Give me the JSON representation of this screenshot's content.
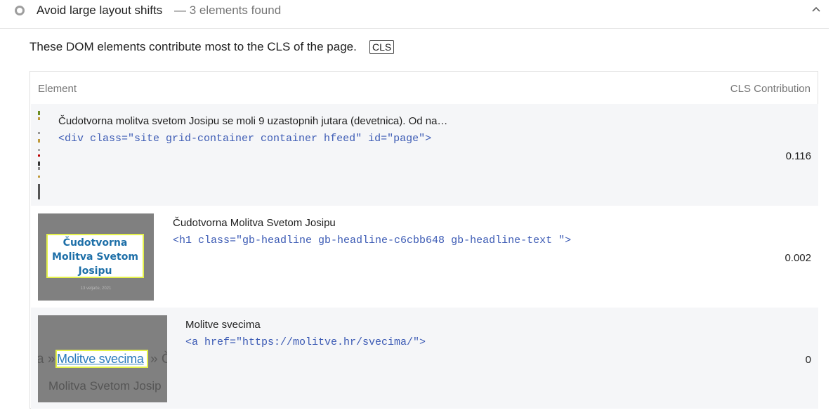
{
  "audit": {
    "title": "Avoid large layout shifts",
    "count": "— 3 elements found",
    "description": "These DOM elements contribute most to the CLS of the page.",
    "tag": "CLS"
  },
  "table": {
    "headers": {
      "element": "Element",
      "contribution": "CLS Contribution"
    },
    "rows": [
      {
        "text": "Čudotvorna molitva svetom Josipu se moli 9 uzastopnih jutara (devetnica). Od na…",
        "code": "<div class=\"site grid-container container hfeed\" id=\"page\">",
        "value": "0.116"
      },
      {
        "text": "Čudotvorna Molitva Svetom Josipu",
        "code": "<h1 class=\"gb-headline gb-headline-c6cbb648 gb-headline-text \">",
        "value": "0.002",
        "thumb": {
          "title_line1": "Čudotvorna",
          "title_line2": "Molitva Svetom",
          "title_line3": "Josipu",
          "date": "13 veljače, 2021"
        }
      },
      {
        "text": "Molitve svecima",
        "code": "<a href=\"https://molitve.hr/svecima/\">",
        "value": "0",
        "thumb": {
          "link": "Molitve svecima",
          "left_fragment": "a »",
          "right_fragment": "» Č",
          "below": "Molitva Svetom Josip"
        }
      }
    ]
  },
  "colors": {
    "code": "#3b5ab4",
    "row_alt": "#f5f6f8",
    "highlight": "#e4f14a"
  },
  "icons": {
    "status": "status-circle-icon",
    "collapse": "chevron-up-icon"
  }
}
